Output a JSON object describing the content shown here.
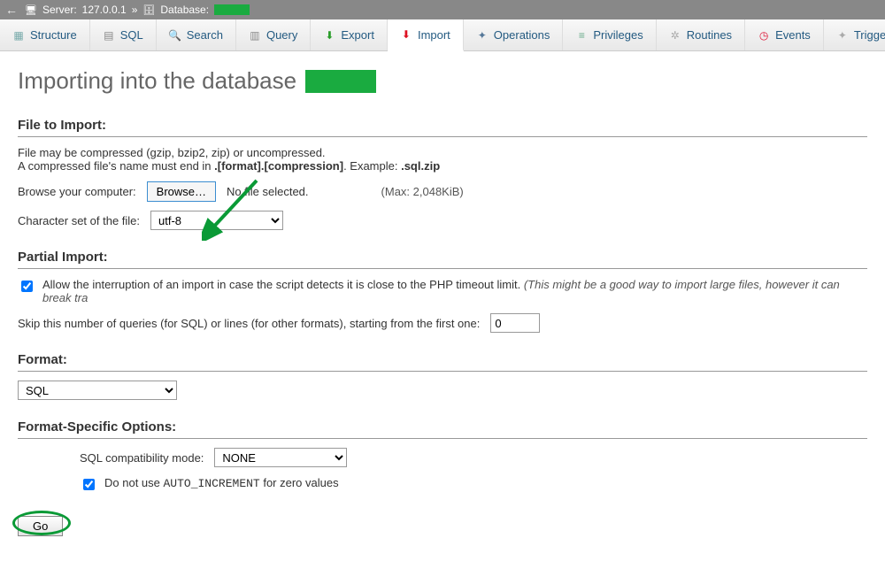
{
  "breadcrumb": {
    "server_label": "Server:",
    "server_value": "127.0.0.1",
    "sep": "»",
    "database_label": "Database:"
  },
  "tabs": [
    {
      "id": "structure",
      "label": "Structure"
    },
    {
      "id": "sql",
      "label": "SQL"
    },
    {
      "id": "search",
      "label": "Search"
    },
    {
      "id": "query",
      "label": "Query"
    },
    {
      "id": "export",
      "label": "Export"
    },
    {
      "id": "import",
      "label": "Import",
      "active": true
    },
    {
      "id": "operations",
      "label": "Operations"
    },
    {
      "id": "privileges",
      "label": "Privileges"
    },
    {
      "id": "routines",
      "label": "Routines"
    },
    {
      "id": "events",
      "label": "Events"
    },
    {
      "id": "triggers",
      "label": "Triggers"
    }
  ],
  "heading": "Importing into the database",
  "sections": {
    "file": "File to Import:",
    "partial": "Partial Import:",
    "format": "Format:",
    "format_opts": "Format-Specific Options:"
  },
  "file": {
    "hint1": "File may be compressed (gzip, bzip2, zip) or uncompressed.",
    "hint2a": "A compressed file's name must end in ",
    "hint2b": ".[format].[compression]",
    "hint2c": ". Example: ",
    "hint2d": ".sql.zip",
    "browse_label": "Browse your computer:",
    "browse_btn": "Browse…",
    "no_file": "No file selected.",
    "max": "(Max: 2,048KiB)",
    "charset_label": "Character set of the file:",
    "charset_value": "utf-8"
  },
  "partial": {
    "allow_label": "Allow the interruption of an import in case the script detects it is close to the PHP timeout limit. ",
    "allow_note": "(This might be a good way to import large files, however it can break tra",
    "skip_label": "Skip this number of queries (for SQL) or lines (for other formats), starting from the first one:",
    "skip_value": 0
  },
  "format_select": "SQL",
  "format_opts": {
    "compat_label": "SQL compatibility mode:",
    "compat_value": "NONE",
    "noautoinc_a": "Do not use ",
    "noautoinc_b": "AUTO_INCREMENT",
    "noautoinc_c": " for zero values"
  },
  "go": "Go"
}
